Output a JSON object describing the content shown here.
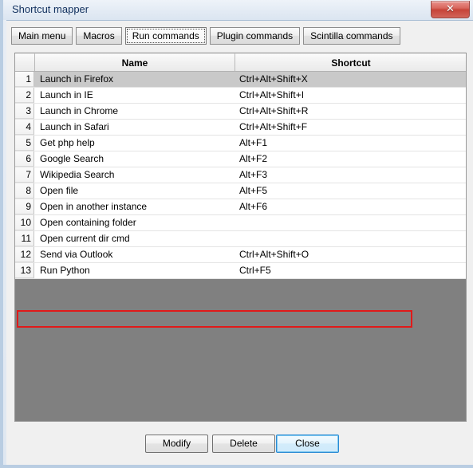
{
  "window": {
    "title": "Shortcut mapper",
    "close_icon": "close-icon",
    "close_label": "✕"
  },
  "tabs": [
    {
      "label": "Main menu",
      "selected": false
    },
    {
      "label": "Macros",
      "selected": false
    },
    {
      "label": "Run commands",
      "selected": true
    },
    {
      "label": "Plugin commands",
      "selected": false
    },
    {
      "label": "Scintilla commands",
      "selected": false
    }
  ],
  "table": {
    "columns": [
      "",
      "Name",
      "Shortcut"
    ],
    "rows": [
      {
        "index": "1",
        "name": "Launch in Firefox",
        "shortcut": "Ctrl+Alt+Shift+X",
        "selected": true,
        "highlighted": false
      },
      {
        "index": "2",
        "name": "Launch in IE",
        "shortcut": "Ctrl+Alt+Shift+I",
        "selected": false,
        "highlighted": false
      },
      {
        "index": "3",
        "name": "Launch in Chrome",
        "shortcut": "Ctrl+Alt+Shift+R",
        "selected": false,
        "highlighted": false
      },
      {
        "index": "4",
        "name": "Launch in Safari",
        "shortcut": "Ctrl+Alt+Shift+F",
        "selected": false,
        "highlighted": false
      },
      {
        "index": "5",
        "name": "Get php help",
        "shortcut": "Alt+F1",
        "selected": false,
        "highlighted": false
      },
      {
        "index": "6",
        "name": "Google Search",
        "shortcut": "Alt+F2",
        "selected": false,
        "highlighted": false
      },
      {
        "index": "7",
        "name": "Wikipedia Search",
        "shortcut": "Alt+F3",
        "selected": false,
        "highlighted": false
      },
      {
        "index": "8",
        "name": "Open file",
        "shortcut": "Alt+F5",
        "selected": false,
        "highlighted": false
      },
      {
        "index": "9",
        "name": "Open in another instance",
        "shortcut": "Alt+F6",
        "selected": false,
        "highlighted": false
      },
      {
        "index": "10",
        "name": "Open containing folder",
        "shortcut": "",
        "selected": false,
        "highlighted": false
      },
      {
        "index": "11",
        "name": "Open current dir cmd",
        "shortcut": "",
        "selected": false,
        "highlighted": false
      },
      {
        "index": "12",
        "name": "Send via Outlook",
        "shortcut": "Ctrl+Alt+Shift+O",
        "selected": false,
        "highlighted": false
      },
      {
        "index": "13",
        "name": "Run Python",
        "shortcut": "Ctrl+F5",
        "selected": false,
        "highlighted": true
      }
    ]
  },
  "buttons": {
    "modify": "Modify",
    "delete": "Delete",
    "close": "Close"
  },
  "colors": {
    "annotation": "#e11919",
    "selection": "#c9c9c9",
    "empty_area": "#808080",
    "default_button_border": "#2a8ad4"
  }
}
